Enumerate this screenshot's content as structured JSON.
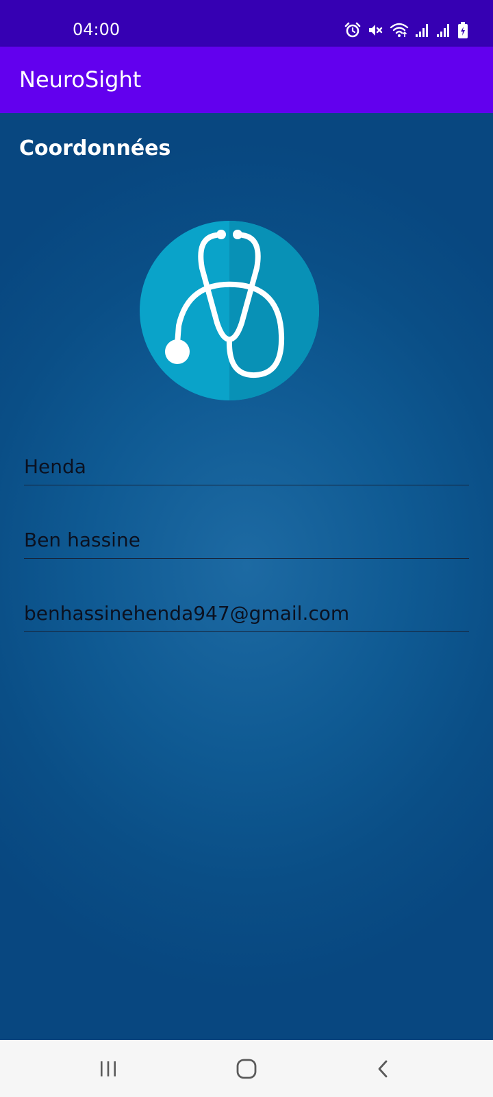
{
  "status_bar": {
    "time": "04:00",
    "icons": [
      "alarm-icon",
      "mute-icon",
      "wifi-icon",
      "signal-icon",
      "signal-icon",
      "battery-charging-icon"
    ]
  },
  "app_bar": {
    "title": "NeuroSight"
  },
  "main": {
    "section_title": "Coordonnées",
    "logo_icon": "stethoscope-icon",
    "fields": {
      "first_name": "Henda",
      "last_name": "Ben hassine",
      "email": "benhassinehenda947@gmail.com"
    }
  },
  "nav_bar": {
    "icons": [
      "recents-icon",
      "home-icon",
      "back-icon"
    ]
  },
  "colors": {
    "status_bar": "#3600b3",
    "app_bar": "#6200ee",
    "background": "#0a4f86",
    "logo_circle": "#0aa3c9",
    "logo_circle_shade": "#0891b6"
  }
}
